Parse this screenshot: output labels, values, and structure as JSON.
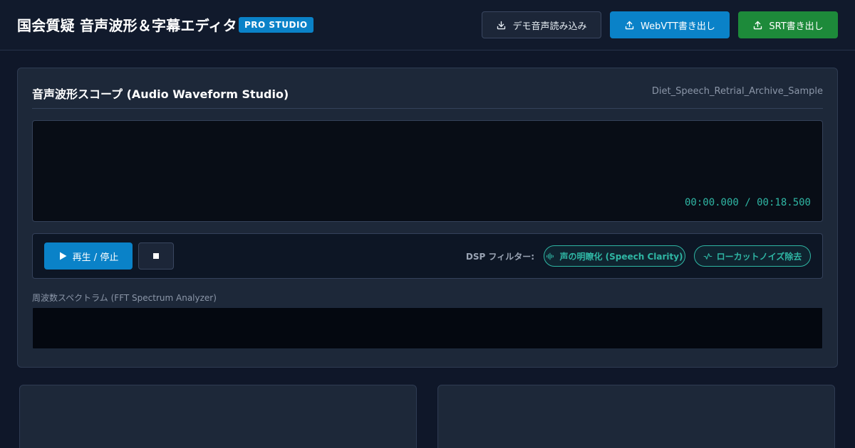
{
  "header": {
    "title": "国会質疑 音声波形＆字幕エディタ",
    "badge": "PRO STUDIO",
    "buttons": {
      "demo_label": "デモ音声読み込み",
      "demo_icon": "download-icon",
      "vtt_label": "WebVTT書き出し",
      "vtt_icon": "upload-icon",
      "srt_label": "SRT書き出し",
      "srt_icon": "upload-icon"
    }
  },
  "waveform_panel": {
    "title": "音声波形スコープ (Audio Waveform Studio)",
    "file_name": "Diet_Speech_Retrial_Archive_Sample",
    "time_display": "00:00.000 / 00:18.500"
  },
  "controls": {
    "play_label": "再生 / 停止",
    "play_icon": "play-icon",
    "stop_icon": "stop-icon",
    "dsp_label": "DSP フィルター:",
    "dsp_clarity_label": "声の明瞭化 (Speech Clarity)",
    "dsp_clarity_icon": "audio-wave-icon",
    "dsp_lowcut_label": "ローカットノイズ除去",
    "dsp_lowcut_icon": "activity-icon"
  },
  "spectrum": {
    "label": "周波数スペクトラム (FFT Spectrum Analyzer)"
  },
  "colors": {
    "background": "#0f1729",
    "accent_blue": "#0a82c8",
    "accent_green": "#1d8a3a",
    "accent_teal": "#2fb6a4",
    "panel": "#1d2839"
  }
}
